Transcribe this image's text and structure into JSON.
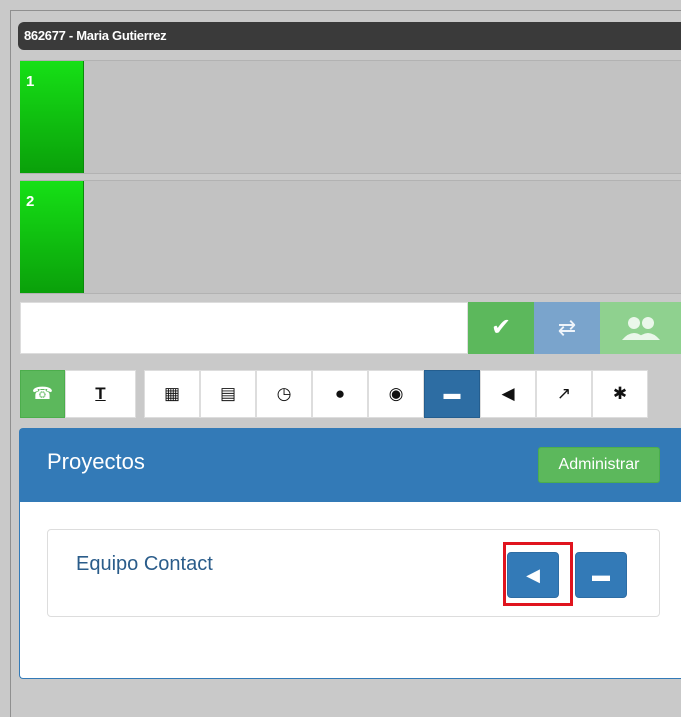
{
  "titlebar": {
    "text": "862677 - Maria Gutierrez"
  },
  "lines": [
    {
      "number": "1",
      "status_color": "#12d012"
    },
    {
      "number": "2",
      "status_color": "#12d012"
    }
  ],
  "dialer": {
    "input_value": "",
    "confirm_icon": "check-icon",
    "transfer_icon": "transfer-icon",
    "conference_icon": "users-icon"
  },
  "toolbar": {
    "group1": [
      {
        "icon": "phone-icon",
        "glyph": "☎",
        "active": "green"
      },
      {
        "icon": "text-icon",
        "glyph": "T",
        "active": ""
      }
    ],
    "group2": [
      {
        "icon": "keypad-icon",
        "glyph": "▦",
        "active": ""
      },
      {
        "icon": "list-icon",
        "glyph": "▤",
        "active": ""
      },
      {
        "icon": "clock-icon",
        "glyph": "◷",
        "active": ""
      },
      {
        "icon": "user-icon",
        "glyph": "●",
        "active": ""
      },
      {
        "icon": "globe-icon",
        "glyph": "◉",
        "active": ""
      },
      {
        "icon": "chat-icon",
        "glyph": "▬",
        "active": "blue"
      },
      {
        "icon": "megaphone-icon",
        "glyph": "◀",
        "active": ""
      },
      {
        "icon": "share-icon",
        "glyph": "↗",
        "active": ""
      },
      {
        "icon": "gear-icon",
        "glyph": "✱",
        "active": ""
      }
    ]
  },
  "projects": {
    "title": "Proyectos",
    "admin_label": "Administrar",
    "items": [
      {
        "name": "Equipo Contact",
        "actions": [
          "megaphone-icon",
          "chat-icon"
        ]
      }
    ]
  },
  "colors": {
    "primary": "#337ab7",
    "success": "#5cb85c",
    "line_green": "#12d012",
    "highlight": "#e0141e"
  }
}
